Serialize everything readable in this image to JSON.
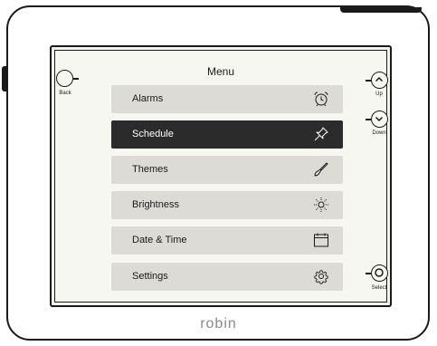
{
  "screen": {
    "title": "Menu"
  },
  "buttons": {
    "back": {
      "label": "Back",
      "icon": "circle-icon"
    },
    "up": {
      "label": "Up",
      "icon": "chevron-up-icon"
    },
    "down": {
      "label": "Down",
      "icon": "chevron-down-icon"
    },
    "select": {
      "label": "Select",
      "icon": "circle-icon"
    }
  },
  "menu": {
    "items": [
      {
        "label": "Alarms",
        "icon": "alarm-clock-icon",
        "selected": false
      },
      {
        "label": "Schedule",
        "icon": "pushpin-icon",
        "selected": true
      },
      {
        "label": "Themes",
        "icon": "paintbrush-icon",
        "selected": false
      },
      {
        "label": "Brightness",
        "icon": "sun-icon",
        "selected": false
      },
      {
        "label": "Date & Time",
        "icon": "calendar-icon",
        "selected": false
      },
      {
        "label": "Settings",
        "icon": "gear-icon",
        "selected": false
      }
    ]
  },
  "brand": {
    "name": "robin"
  },
  "colors": {
    "selected_bg": "#2b2b2b",
    "item_bg": "#dcdbd5",
    "screen_bg": "#f7f7f2",
    "outline": "#1a1a1a"
  }
}
